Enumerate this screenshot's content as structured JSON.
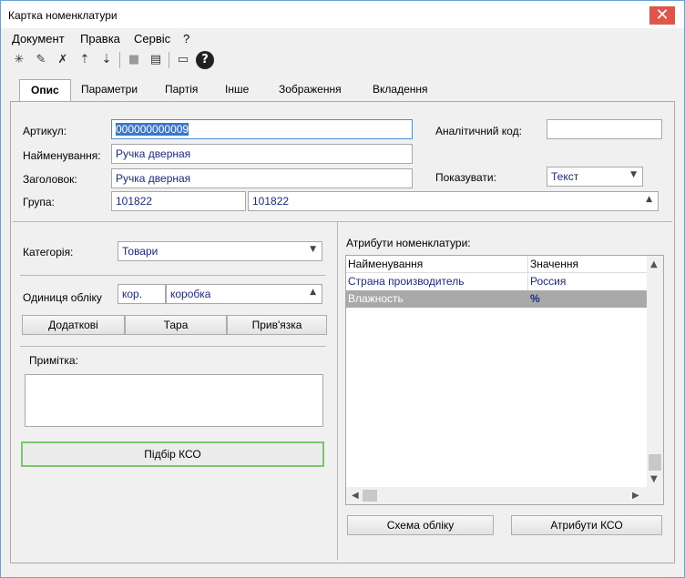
{
  "window": {
    "title": "Картка номенклатури"
  },
  "menu": [
    "Документ",
    "Правка",
    "Сервіс",
    "?"
  ],
  "tabs": [
    "Опис",
    "Параметри",
    "Партія",
    "Інше",
    "Зображення",
    "Вкладення"
  ],
  "form": {
    "article_label": "Артикул:",
    "article_value": "000000000009",
    "analytic_code_label": "Аналітичний код:",
    "analytic_code_value": "",
    "name_label": "Найменування:",
    "name_value": "Ручка дверная",
    "heading_label": "Заголовок:",
    "heading_value": "Ручка дверная",
    "show_label": "Показувати:",
    "show_value": "Текст",
    "group_label": "Група:",
    "group_code": "101822",
    "group_name": "101822"
  },
  "left": {
    "category_label": "Категорія:",
    "category_value": "Товари",
    "unit_label": "Одиниця обліку",
    "unit_short": "кор.",
    "unit_full": "коробка",
    "btn_additional": "Додаткові",
    "btn_tara": "Тара",
    "btn_binding": "Прив'язка",
    "note_label": "Примітка:",
    "note_value": "",
    "btn_kso": "Підбір КСО"
  },
  "attributes": {
    "title": "Атрибути номенклатури:",
    "columns": [
      "Найменування",
      "Значення"
    ],
    "rows": [
      {
        "name": "Страна производитель",
        "value": "Россия"
      },
      {
        "name": "Влажность",
        "value": "%"
      }
    ],
    "btn_scheme": "Схема обліку",
    "btn_kso_attrs": "Атрибути КСО"
  }
}
